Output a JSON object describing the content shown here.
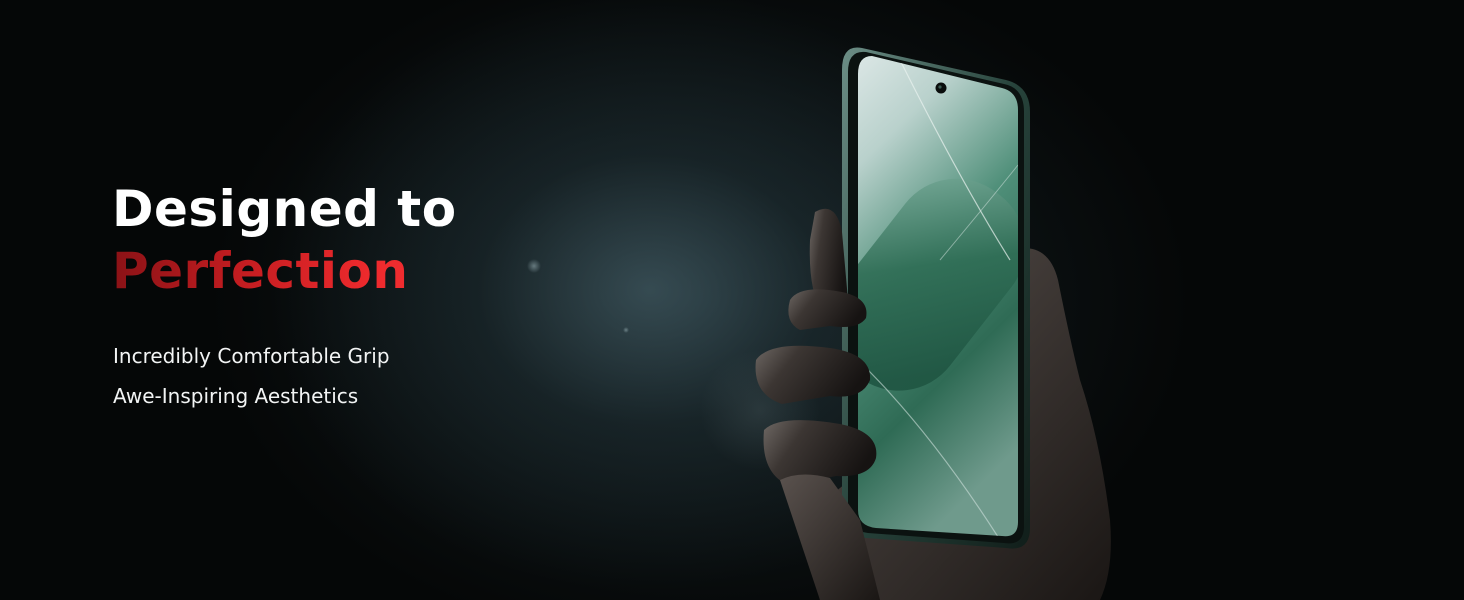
{
  "headline": {
    "line1": "Designed to",
    "line2": "Perfection"
  },
  "features": [
    "Incredibly Comfortable Grip",
    "Awe-Inspiring Aesthetics"
  ],
  "colors": {
    "background": "#050707",
    "headline_primary": "#ffffff",
    "headline_accent": "#e8262a",
    "body_text": "#f2f4f4",
    "screen_green": "#2f6b55"
  }
}
